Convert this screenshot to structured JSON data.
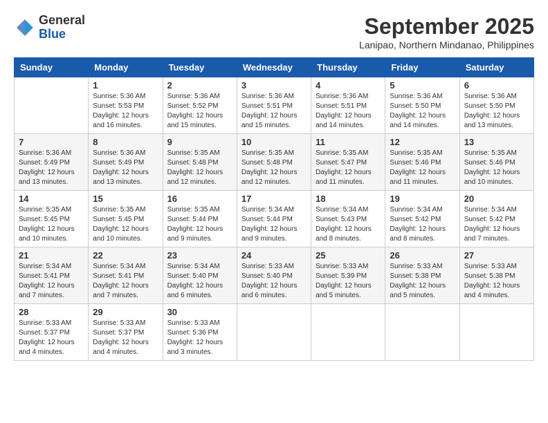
{
  "logo": {
    "general": "General",
    "blue": "Blue"
  },
  "title": "September 2025",
  "subtitle": "Lanipao, Northern Mindanao, Philippines",
  "days": [
    "Sunday",
    "Monday",
    "Tuesday",
    "Wednesday",
    "Thursday",
    "Friday",
    "Saturday"
  ],
  "weeks": [
    [
      {
        "date": "",
        "sunrise": "",
        "sunset": "",
        "daylight": ""
      },
      {
        "date": "1",
        "sunrise": "Sunrise: 5:36 AM",
        "sunset": "Sunset: 5:53 PM",
        "daylight": "Daylight: 12 hours and 16 minutes."
      },
      {
        "date": "2",
        "sunrise": "Sunrise: 5:36 AM",
        "sunset": "Sunset: 5:52 PM",
        "daylight": "Daylight: 12 hours and 15 minutes."
      },
      {
        "date": "3",
        "sunrise": "Sunrise: 5:36 AM",
        "sunset": "Sunset: 5:51 PM",
        "daylight": "Daylight: 12 hours and 15 minutes."
      },
      {
        "date": "4",
        "sunrise": "Sunrise: 5:36 AM",
        "sunset": "Sunset: 5:51 PM",
        "daylight": "Daylight: 12 hours and 14 minutes."
      },
      {
        "date": "5",
        "sunrise": "Sunrise: 5:36 AM",
        "sunset": "Sunset: 5:50 PM",
        "daylight": "Daylight: 12 hours and 14 minutes."
      },
      {
        "date": "6",
        "sunrise": "Sunrise: 5:36 AM",
        "sunset": "Sunset: 5:50 PM",
        "daylight": "Daylight: 12 hours and 13 minutes."
      }
    ],
    [
      {
        "date": "7",
        "sunrise": "Sunrise: 5:36 AM",
        "sunset": "Sunset: 5:49 PM",
        "daylight": "Daylight: 12 hours and 13 minutes."
      },
      {
        "date": "8",
        "sunrise": "Sunrise: 5:36 AM",
        "sunset": "Sunset: 5:49 PM",
        "daylight": "Daylight: 12 hours and 13 minutes."
      },
      {
        "date": "9",
        "sunrise": "Sunrise: 5:35 AM",
        "sunset": "Sunset: 5:48 PM",
        "daylight": "Daylight: 12 hours and 12 minutes."
      },
      {
        "date": "10",
        "sunrise": "Sunrise: 5:35 AM",
        "sunset": "Sunset: 5:48 PM",
        "daylight": "Daylight: 12 hours and 12 minutes."
      },
      {
        "date": "11",
        "sunrise": "Sunrise: 5:35 AM",
        "sunset": "Sunset: 5:47 PM",
        "daylight": "Daylight: 12 hours and 11 minutes."
      },
      {
        "date": "12",
        "sunrise": "Sunrise: 5:35 AM",
        "sunset": "Sunset: 5:46 PM",
        "daylight": "Daylight: 12 hours and 11 minutes."
      },
      {
        "date": "13",
        "sunrise": "Sunrise: 5:35 AM",
        "sunset": "Sunset: 5:46 PM",
        "daylight": "Daylight: 12 hours and 10 minutes."
      }
    ],
    [
      {
        "date": "14",
        "sunrise": "Sunrise: 5:35 AM",
        "sunset": "Sunset: 5:45 PM",
        "daylight": "Daylight: 12 hours and 10 minutes."
      },
      {
        "date": "15",
        "sunrise": "Sunrise: 5:35 AM",
        "sunset": "Sunset: 5:45 PM",
        "daylight": "Daylight: 12 hours and 10 minutes."
      },
      {
        "date": "16",
        "sunrise": "Sunrise: 5:35 AM",
        "sunset": "Sunset: 5:44 PM",
        "daylight": "Daylight: 12 hours and 9 minutes."
      },
      {
        "date": "17",
        "sunrise": "Sunrise: 5:34 AM",
        "sunset": "Sunset: 5:44 PM",
        "daylight": "Daylight: 12 hours and 9 minutes."
      },
      {
        "date": "18",
        "sunrise": "Sunrise: 5:34 AM",
        "sunset": "Sunset: 5:43 PM",
        "daylight": "Daylight: 12 hours and 8 minutes."
      },
      {
        "date": "19",
        "sunrise": "Sunrise: 5:34 AM",
        "sunset": "Sunset: 5:42 PM",
        "daylight": "Daylight: 12 hours and 8 minutes."
      },
      {
        "date": "20",
        "sunrise": "Sunrise: 5:34 AM",
        "sunset": "Sunset: 5:42 PM",
        "daylight": "Daylight: 12 hours and 7 minutes."
      }
    ],
    [
      {
        "date": "21",
        "sunrise": "Sunrise: 5:34 AM",
        "sunset": "Sunset: 5:41 PM",
        "daylight": "Daylight: 12 hours and 7 minutes."
      },
      {
        "date": "22",
        "sunrise": "Sunrise: 5:34 AM",
        "sunset": "Sunset: 5:41 PM",
        "daylight": "Daylight: 12 hours and 7 minutes."
      },
      {
        "date": "23",
        "sunrise": "Sunrise: 5:34 AM",
        "sunset": "Sunset: 5:40 PM",
        "daylight": "Daylight: 12 hours and 6 minutes."
      },
      {
        "date": "24",
        "sunrise": "Sunrise: 5:33 AM",
        "sunset": "Sunset: 5:40 PM",
        "daylight": "Daylight: 12 hours and 6 minutes."
      },
      {
        "date": "25",
        "sunrise": "Sunrise: 5:33 AM",
        "sunset": "Sunset: 5:39 PM",
        "daylight": "Daylight: 12 hours and 5 minutes."
      },
      {
        "date": "26",
        "sunrise": "Sunrise: 5:33 AM",
        "sunset": "Sunset: 5:38 PM",
        "daylight": "Daylight: 12 hours and 5 minutes."
      },
      {
        "date": "27",
        "sunrise": "Sunrise: 5:33 AM",
        "sunset": "Sunset: 5:38 PM",
        "daylight": "Daylight: 12 hours and 4 minutes."
      }
    ],
    [
      {
        "date": "28",
        "sunrise": "Sunrise: 5:33 AM",
        "sunset": "Sunset: 5:37 PM",
        "daylight": "Daylight: 12 hours and 4 minutes."
      },
      {
        "date": "29",
        "sunrise": "Sunrise: 5:33 AM",
        "sunset": "Sunset: 5:37 PM",
        "daylight": "Daylight: 12 hours and 4 minutes."
      },
      {
        "date": "30",
        "sunrise": "Sunrise: 5:33 AM",
        "sunset": "Sunset: 5:36 PM",
        "daylight": "Daylight: 12 hours and 3 minutes."
      },
      {
        "date": "",
        "sunrise": "",
        "sunset": "",
        "daylight": ""
      },
      {
        "date": "",
        "sunrise": "",
        "sunset": "",
        "daylight": ""
      },
      {
        "date": "",
        "sunrise": "",
        "sunset": "",
        "daylight": ""
      },
      {
        "date": "",
        "sunrise": "",
        "sunset": "",
        "daylight": ""
      }
    ]
  ]
}
